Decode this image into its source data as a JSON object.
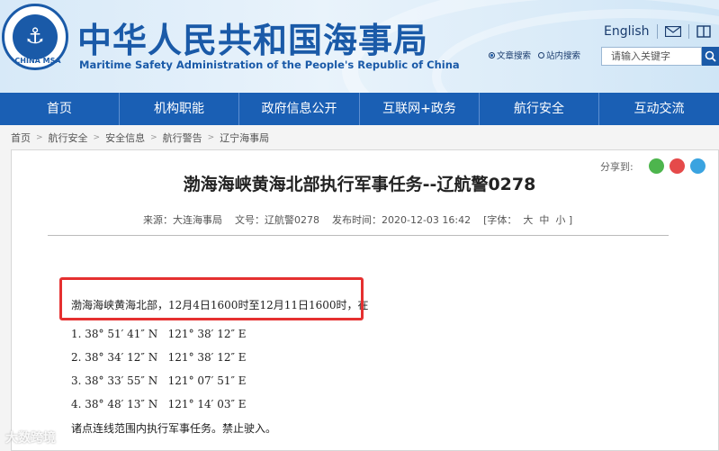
{
  "header": {
    "logo_text": "CHINA MSA",
    "title": "中华人民共和国海事局",
    "subtitle": "Maritime Safety Administration of the People's Republic of China",
    "english_link": "English",
    "search": {
      "option_doc": "文章搜索",
      "option_site": "站内搜索",
      "placeholder": "请输入关键字"
    }
  },
  "nav": {
    "items": [
      "首页",
      "机构职能",
      "政府信息公开",
      "互联网+政务",
      "航行安全",
      "互动交流"
    ]
  },
  "breadcrumb": [
    "首页",
    "航行安全",
    "安全信息",
    "航行警告",
    "辽宁海事局"
  ],
  "article": {
    "share_label": "分享到:",
    "title": "渤海海峡黄海北部执行军事任务--辽航警0278",
    "source": "来源：大连海事局",
    "doc_no": "文号：辽航警0278",
    "published": "发布时间：2020-12-03 16:42",
    "font_size": "[字体：  大  中  小 ]",
    "intro": "渤海海峡黄海北部，12月4日1600时至12月11日1600时，在",
    "points": [
      "1. 38° 51′ 41″ N   121° 38′ 12″ E",
      "2. 38° 34′ 12″ N   121° 38′ 12″ E",
      "3. 38° 33′ 55″ N   121° 07′ 51″ E",
      "4. 38° 48′ 13″ N   121° 14′ 03″ E"
    ],
    "closing": "诸点连线范围内执行军事任务。禁止驶入。"
  },
  "watermark": "大数跨境",
  "colors": {
    "brand": "#1a5aa8",
    "nav": "#1a5fb4",
    "highlight": "#e53030"
  }
}
